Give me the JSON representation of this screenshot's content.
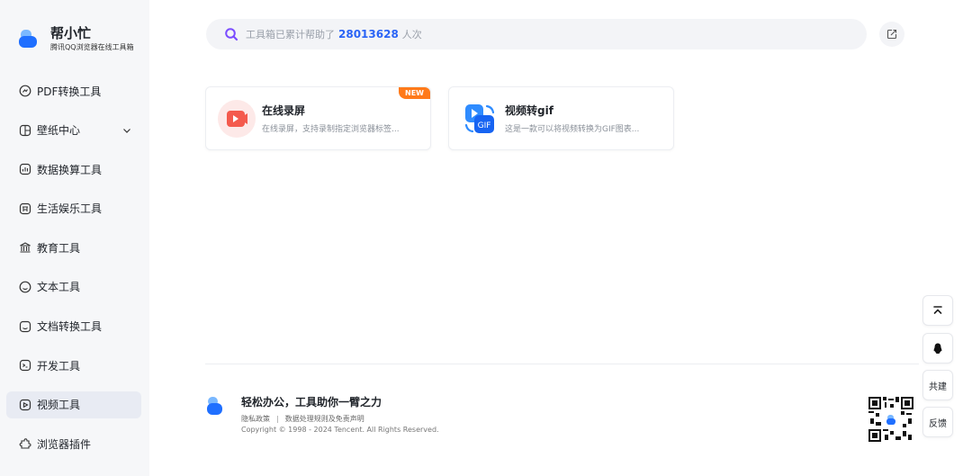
{
  "brand": {
    "title": "帮小忙",
    "subtitle": "腾讯QQ浏览器在线工具箱"
  },
  "sidebar": {
    "items": [
      {
        "label": "PDF转换工具",
        "icon": "pdf-icon"
      },
      {
        "label": "壁纸中心",
        "icon": "wallpaper-icon",
        "has_dropdown": true
      },
      {
        "label": "数据换算工具",
        "icon": "calculator-icon"
      },
      {
        "label": "生活娱乐工具",
        "icon": "entertainment-icon"
      },
      {
        "label": "教育工具",
        "icon": "education-icon"
      },
      {
        "label": "文本工具",
        "icon": "text-icon"
      },
      {
        "label": "文档转换工具",
        "icon": "document-convert-icon"
      },
      {
        "label": "开发工具",
        "icon": "code-icon"
      },
      {
        "label": "视频工具",
        "icon": "video-icon",
        "active": true
      },
      {
        "label": "浏览器插件",
        "icon": "plugin-icon"
      }
    ]
  },
  "search": {
    "prefix": "工具箱已累计帮助了",
    "count": "28013628",
    "suffix": "人次"
  },
  "cards": [
    {
      "title": "在线录屏",
      "desc": "在线录屏，支持录制指定浏览器标签...",
      "badge": "NEW",
      "icon": "screen-record-icon"
    },
    {
      "title": "视频转gif",
      "desc": "这是一款可以将视频转换为GIF图表...",
      "icon": "video-to-gif-icon",
      "icon_text": "GIF"
    }
  ],
  "footer": {
    "slogan": "轻松办公，工具助你一臂之力",
    "privacy": "隐私政策",
    "separator": "|",
    "data_rules": "数据处理规则及免责声明",
    "copyright": "Copyright © 1998 - 2024 Tencent. All Rights Reserved."
  },
  "float_buttons": {
    "cobuild": "共建",
    "feedback": "反馈"
  },
  "colors": {
    "accent": "#2a64f6",
    "badge": "#ff7a1a",
    "sidebar_bg": "#f6f7f9",
    "active_bg": "#e8ebf3"
  }
}
